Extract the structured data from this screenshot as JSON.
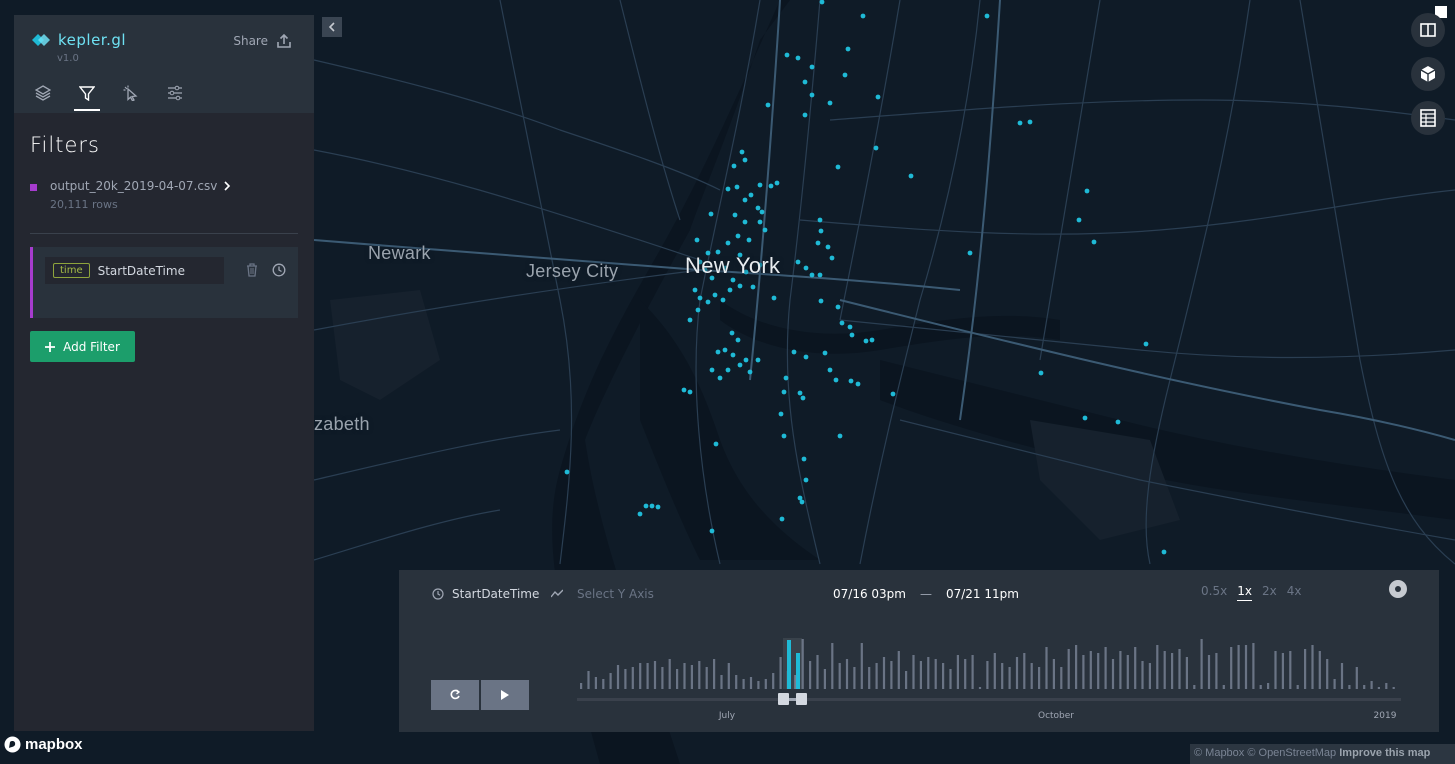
{
  "app": {
    "name": "kepler.gl",
    "version": "v1.0",
    "share_label": "Share"
  },
  "map": {
    "labels": {
      "newark": "Newark",
      "jersey_city": "Jersey City",
      "new_york": "New York",
      "elizabeth": "zabeth"
    },
    "point_color": "#1fbad6"
  },
  "side_panel": {
    "tabs": [
      "layers-icon",
      "filter-icon",
      "interaction-icon",
      "map-style-icon"
    ],
    "active_tab": "filter-icon",
    "title": "Filters",
    "dataset": {
      "name": "output_20k_2019-04-07.csv",
      "rows": "20,111 rows",
      "color": "#a63cce"
    },
    "filter": {
      "type_tag": "time",
      "field": "StartDateTime"
    },
    "add_filter_label": "Add Filter"
  },
  "timeline": {
    "field": "StartDateTime",
    "y_axis_placeholder": "Select Y Axis",
    "range_start": "07/16 03pm",
    "range_end": "07/21 11pm",
    "speeds": [
      "0.5x",
      "1x",
      "2x",
      "4x"
    ],
    "active_speed": "1x",
    "axis_ticks": [
      "July",
      "October",
      "2019"
    ]
  },
  "footer": {
    "mapbox_label": "mapbox",
    "attribution": "© Mapbox © OpenStreetMap",
    "improve": "Improve this map"
  }
}
